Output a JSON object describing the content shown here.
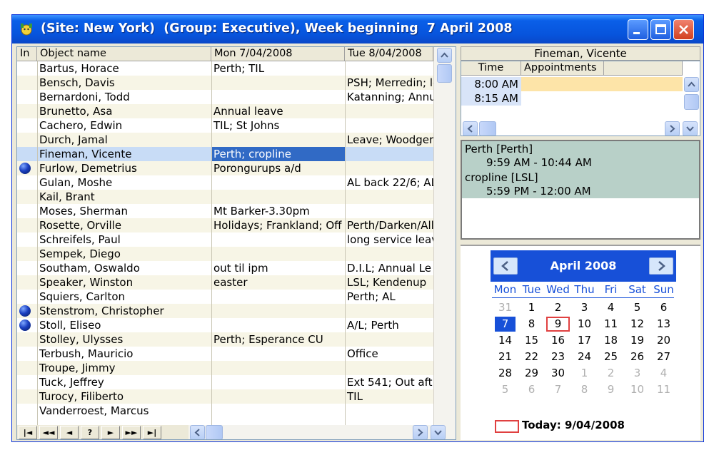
{
  "window": {
    "title": "(Site: New York)  (Group: Executive), Week beginning  7 April 2008"
  },
  "grid": {
    "columns": [
      "In",
      "Object name",
      "Mon   7/04/2008",
      "Tue   8/04/2008"
    ],
    "rows": [
      {
        "in": false,
        "name": "Bartus, Horace",
        "mon": "Perth; TIL",
        "tue": ""
      },
      {
        "in": false,
        "name": "Bensch, Davis",
        "mon": "",
        "tue": "PSH; Merredin; le"
      },
      {
        "in": false,
        "name": "Bernardoni, Todd",
        "mon": "",
        "tue": "Katanning; Annu"
      },
      {
        "in": false,
        "name": "Brunetto, Asa",
        "mon": "Annual leave",
        "tue": ""
      },
      {
        "in": false,
        "name": "Cachero, Edwin",
        "mon": "TIL; St Johns",
        "tue": ""
      },
      {
        "in": false,
        "name": "Durch, Jamal",
        "mon": "",
        "tue": "Leave; Woodger"
      },
      {
        "in": false,
        "name": "Fineman, Vicente",
        "mon": "Perth; cropline",
        "tue": ""
      },
      {
        "in": true,
        "name": "Furlow, Demetrius",
        "mon": "Porongurups a/d",
        "tue": ""
      },
      {
        "in": false,
        "name": "Gulan, Moshe",
        "mon": "",
        "tue": "AL back 22/6; AL"
      },
      {
        "in": false,
        "name": "Kail, Brant",
        "mon": "",
        "tue": ""
      },
      {
        "in": false,
        "name": "Moses, Sherman",
        "mon": "Mt Barker-3.30pm",
        "tue": ""
      },
      {
        "in": false,
        "name": "Rosette, Orville",
        "mon": "Holidays; Frankland; Off",
        "tue": "Perth/Darken/All"
      },
      {
        "in": false,
        "name": "Schreifels, Paul",
        "mon": "",
        "tue": "long service leav"
      },
      {
        "in": false,
        "name": "Sempek, Diego",
        "mon": "",
        "tue": ""
      },
      {
        "in": false,
        "name": "Southam, Oswaldo",
        "mon": "out til ipm",
        "tue": "D.I.L; Annual Le"
      },
      {
        "in": false,
        "name": "Speaker, Winston",
        "mon": "easter",
        "tue": "LSL; Kendenup"
      },
      {
        "in": false,
        "name": "Squiers, Carlton",
        "mon": "",
        "tue": "Perth; AL"
      },
      {
        "in": true,
        "name": "Stenstrom, Christopher",
        "mon": "",
        "tue": ""
      },
      {
        "in": true,
        "name": "Stoll, Eliseo",
        "mon": "",
        "tue": "A/L; Perth"
      },
      {
        "in": false,
        "name": "Stolley, Ulysses",
        "mon": "Perth; Esperance CU",
        "tue": ""
      },
      {
        "in": false,
        "name": "Terbush, Mauricio",
        "mon": "",
        "tue": "Office"
      },
      {
        "in": false,
        "name": "Troupe, Jimmy",
        "mon": "",
        "tue": ""
      },
      {
        "in": false,
        "name": "Tuck, Jeffrey",
        "mon": "",
        "tue": "Ext 541; Out aft"
      },
      {
        "in": false,
        "name": "Turocy, Filiberto",
        "mon": "",
        "tue": "TIL"
      },
      {
        "in": false,
        "name": "Vanderroest, Marcus",
        "mon": "",
        "tue": ""
      }
    ],
    "selected_row": 6,
    "nav_buttons": [
      "|◄",
      "◄◄",
      "◄",
      "?",
      "►",
      "►►",
      "►|"
    ]
  },
  "schedule": {
    "person": "Fineman, Vicente",
    "columns": [
      "Time",
      "Appointments"
    ],
    "slots": [
      "8:00 AM",
      "8:15 AM"
    ]
  },
  "appointments": [
    {
      "title": "Perth [Perth]",
      "time": "9:59 AM - 10:44 AM"
    },
    {
      "title": "cropline [LSL]",
      "time": "5:59 PM - 12:00 AM"
    }
  ],
  "calendar": {
    "month_label": "April 2008",
    "dow": [
      "Mon",
      "Tue",
      "Wed",
      "Thu",
      "Fri",
      "Sat",
      "Sun"
    ],
    "weeks": [
      [
        "31",
        "1",
        "2",
        "3",
        "4",
        "5",
        "6"
      ],
      [
        "7",
        "8",
        "9",
        "10",
        "11",
        "12",
        "13"
      ],
      [
        "14",
        "15",
        "16",
        "17",
        "18",
        "19",
        "20"
      ],
      [
        "21",
        "22",
        "23",
        "24",
        "25",
        "26",
        "27"
      ],
      [
        "28",
        "29",
        "30",
        "1",
        "2",
        "3",
        "4"
      ],
      [
        "5",
        "6",
        "7",
        "8",
        "9",
        "10",
        "11"
      ]
    ],
    "selected_day": "7",
    "today_day": "9",
    "today_label": "Today: 9/04/2008"
  },
  "colors": {
    "title_blue": "#0754dc",
    "selection": "#316ac5",
    "calendar_blue": "#1750d8",
    "today_red": "#e04040",
    "appointment_bg": "#b8d0c8"
  }
}
